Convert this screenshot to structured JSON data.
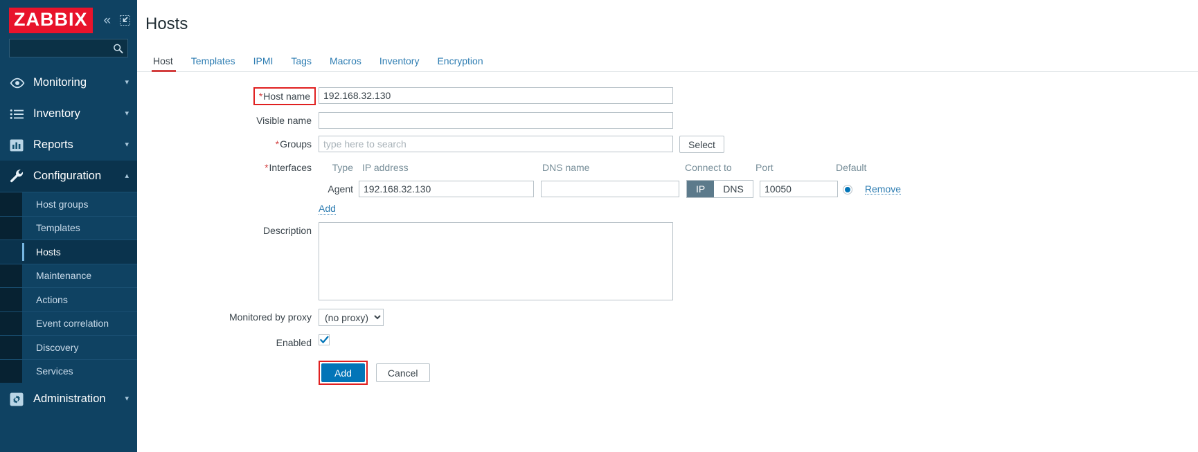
{
  "brand": {
    "logo_text": "ZABBIX"
  },
  "sidebar": {
    "collapse_icon": "chevrons-left-icon",
    "hide_icon": "collapse-sidebar-icon",
    "search": {
      "value": "",
      "placeholder": "",
      "icon": "search-icon"
    },
    "nav": [
      {
        "label": "Monitoring",
        "icon": "eye-icon",
        "chevron": "chevron-down-icon",
        "expanded": false,
        "active": false
      },
      {
        "label": "Inventory",
        "icon": "list-icon",
        "chevron": "chevron-down-icon",
        "expanded": false,
        "active": false
      },
      {
        "label": "Reports",
        "icon": "bar-chart-icon",
        "chevron": "chevron-down-icon",
        "expanded": false,
        "active": false
      },
      {
        "label": "Configuration",
        "icon": "wrench-icon",
        "chevron": "chevron-up-icon",
        "expanded": true,
        "active": true
      },
      {
        "label": "Administration",
        "icon": "gear-icon",
        "chevron": "chevron-down-icon",
        "expanded": false,
        "active": false
      }
    ],
    "configuration_subitems": [
      {
        "label": "Host groups",
        "selected": false
      },
      {
        "label": "Templates",
        "selected": false
      },
      {
        "label": "Hosts",
        "selected": true
      },
      {
        "label": "Maintenance",
        "selected": false
      },
      {
        "label": "Actions",
        "selected": false
      },
      {
        "label": "Event correlation",
        "selected": false
      },
      {
        "label": "Discovery",
        "selected": false
      },
      {
        "label": "Services",
        "selected": false
      }
    ]
  },
  "header": {
    "title": "Hosts"
  },
  "tabs": [
    {
      "label": "Host",
      "active": true
    },
    {
      "label": "Templates",
      "active": false
    },
    {
      "label": "IPMI",
      "active": false
    },
    {
      "label": "Tags",
      "active": false
    },
    {
      "label": "Macros",
      "active": false
    },
    {
      "label": "Inventory",
      "active": false
    },
    {
      "label": "Encryption",
      "active": false
    }
  ],
  "form": {
    "host_name": {
      "label": "Host name",
      "required_marker": "*",
      "value": "192.168.32.130",
      "placeholder": "",
      "highlighted": true
    },
    "visible_name": {
      "label": "Visible name",
      "value": "",
      "placeholder": ""
    },
    "groups": {
      "label": "Groups",
      "required_marker": "*",
      "value": "",
      "placeholder": "type here to search",
      "select_button": "Select"
    },
    "interfaces": {
      "label": "Interfaces",
      "required_marker": "*",
      "columns": {
        "type": "Type",
        "ip_address": "IP address",
        "dns_name": "DNS name",
        "connect_to": "Connect to",
        "port": "Port",
        "default": "Default"
      },
      "rows": [
        {
          "type": "Agent",
          "ip_address": "192.168.32.130",
          "dns_name": "",
          "connect_to_options": [
            "IP",
            "DNS"
          ],
          "connect_to_selected": "IP",
          "port": "10050",
          "default_selected": true,
          "remove_label": "Remove"
        }
      ],
      "add_label": "Add"
    },
    "description": {
      "label": "Description",
      "value": "",
      "placeholder": ""
    },
    "monitored_by_proxy": {
      "label": "Monitored by proxy",
      "selected": "(no proxy)",
      "options": [
        "(no proxy)"
      ]
    },
    "enabled": {
      "label": "Enabled",
      "checked": true
    },
    "actions": {
      "submit_label": "Add",
      "submit_highlighted": true,
      "cancel_label": "Cancel"
    }
  },
  "colors": {
    "sidebar_bg": "#0f4262",
    "sidebar_active_bg": "#0a334d",
    "brand_red": "#e8132b",
    "accent_blue": "#0275b8",
    "link_blue": "#2e7db2",
    "tab_active_underline": "#d33f3f",
    "highlight_outline": "#e02020",
    "toggle_selected_bg": "#5c7a8b"
  }
}
